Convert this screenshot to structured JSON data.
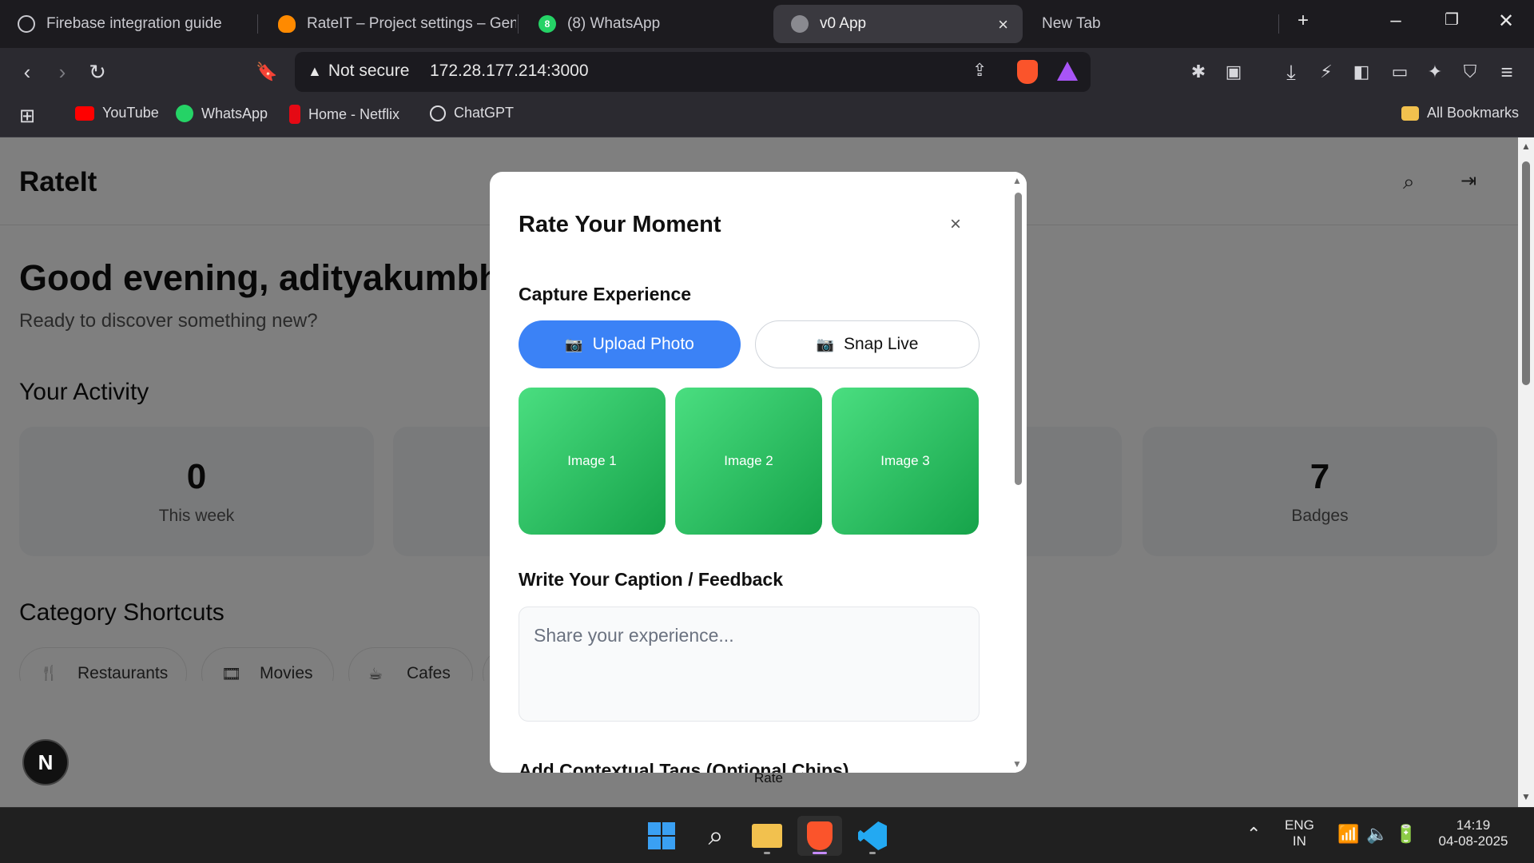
{
  "browser": {
    "tabs": [
      {
        "title": "Firebase integration guide",
        "icon": "chatgpt-icon"
      },
      {
        "title": "RateIT – Project settings – Gene",
        "icon": "firebase-icon"
      },
      {
        "title": "(8) WhatsApp",
        "icon": "whatsapp-icon",
        "badge": "8"
      },
      {
        "title": "v0 App",
        "icon": "globe-icon",
        "active": true
      },
      {
        "title": "New Tab",
        "icon": ""
      }
    ],
    "address": {
      "security_label": "Not secure",
      "url": "172.28.177.214:3000"
    },
    "bookmarks": [
      {
        "label": "YouTube",
        "icon": "youtube-icon",
        "color": "#ff0000"
      },
      {
        "label": "WhatsApp",
        "icon": "whatsapp-icon",
        "color": "#25d366"
      },
      {
        "label": "Home - Netflix",
        "icon": "netflix-icon",
        "color": "#e50914"
      },
      {
        "label": "ChatGPT",
        "icon": "chatgpt-icon",
        "color": "#dcdce0"
      }
    ],
    "all_bookmarks_label": "All Bookmarks"
  },
  "app": {
    "brand": "RateIt",
    "greeting": "Good evening, adityakumbh",
    "subtitle": "Ready to discover something new?",
    "activity_heading": "Your Activity",
    "stats": [
      {
        "value": "0",
        "label": "This week"
      },
      {
        "value": "7",
        "label": "Badges"
      }
    ],
    "categories_heading": "Category Shortcuts",
    "categories": [
      {
        "label": "Restaurants",
        "icon": "fork-knife-icon"
      },
      {
        "label": "Movies",
        "icon": "film-icon"
      },
      {
        "label": "Cafes",
        "icon": "coffee-icon"
      }
    ],
    "dev_badge": "N",
    "bottom_nav_rate": "Rate"
  },
  "modal": {
    "title": "Rate Your Moment",
    "close_symbol": "×",
    "capture_heading": "Capture Experience",
    "upload_label": "Upload Photo",
    "snap_label": "Snap Live",
    "images": [
      "Image 1",
      "Image 2",
      "Image 3"
    ],
    "caption_heading": "Write Your Caption / Feedback",
    "caption_placeholder": "Share your experience...",
    "tags_heading": "Add Contextual Tags (Optional Chips)",
    "accent_color": "#3b82f6"
  },
  "taskbar": {
    "language": "ENG",
    "region": "IN",
    "time": "14:19",
    "date": "04-08-2025"
  }
}
